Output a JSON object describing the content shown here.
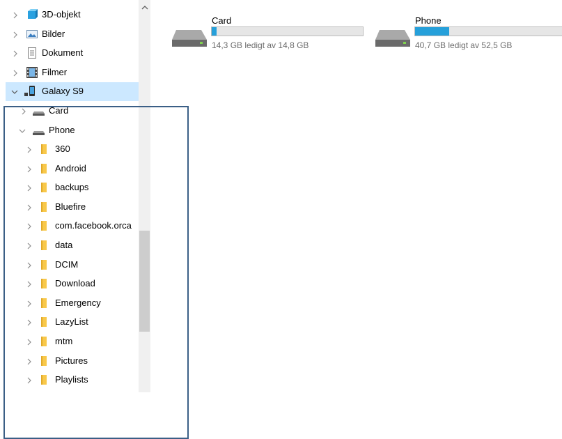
{
  "nav": {
    "items": [
      {
        "label": "3D-objekt",
        "icon": "3d-objects-icon"
      },
      {
        "label": "Bilder",
        "icon": "pictures-icon"
      },
      {
        "label": "Dokument",
        "icon": "documents-icon"
      },
      {
        "label": "Filmer",
        "icon": "videos-icon"
      },
      {
        "label": "Galaxy S9",
        "icon": "phone-device-icon"
      },
      {
        "label": "Card",
        "icon": "drive-icon"
      },
      {
        "label": "Phone",
        "icon": "drive-icon"
      }
    ],
    "folders": [
      "360",
      "Android",
      "backups",
      "Bluefire",
      "com.facebook.orca",
      "data",
      "DCIM",
      "Download",
      "Emergency",
      "LazyList",
      "mtm",
      "Pictures",
      "Playlists"
    ]
  },
  "drives": [
    {
      "name": "Card",
      "free_text": "14,3 GB ledigt av 14,8 GB",
      "used_fraction": 0.034
    },
    {
      "name": "Phone",
      "free_text": "40,7 GB ledigt av 52,5 GB",
      "used_fraction": 0.225
    }
  ],
  "colors": {
    "selection": "#cce8ff",
    "bar_fill": "#26a0da",
    "folder": "#f8c84a",
    "highlight_box": "#3b5f86"
  }
}
